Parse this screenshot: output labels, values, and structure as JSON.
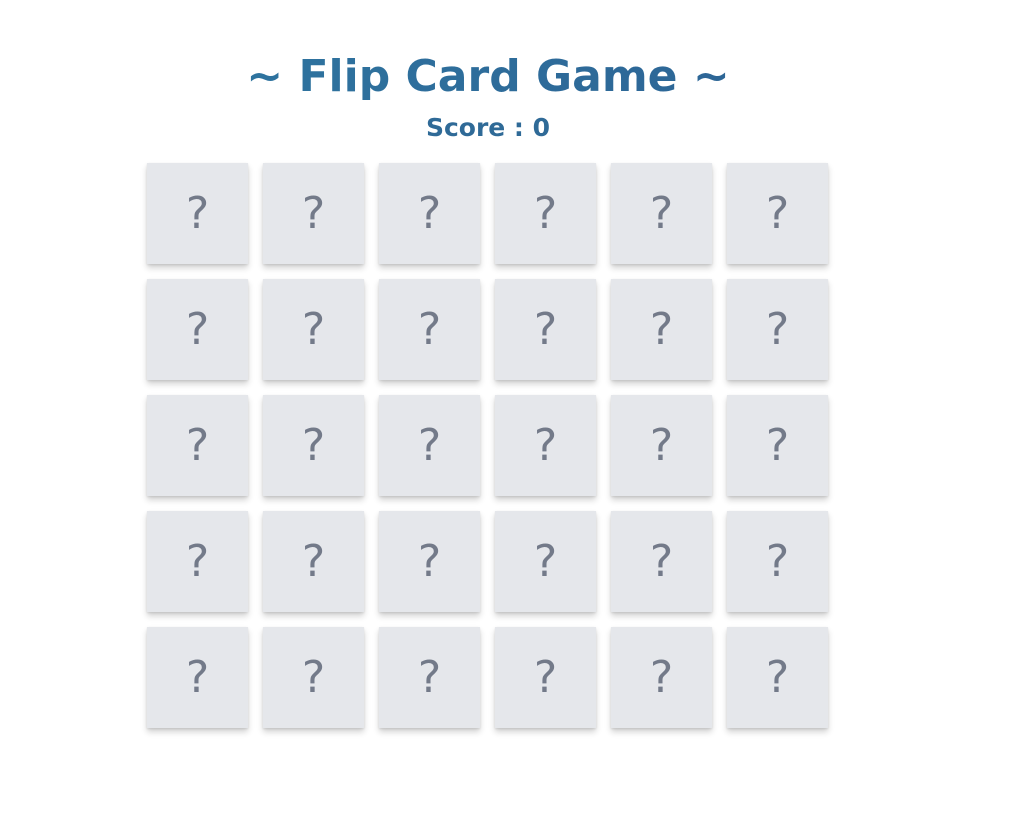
{
  "game": {
    "title": "~ Flip Card Game ~",
    "score_label": "Score : ",
    "score_value": "0"
  },
  "board": {
    "rows": 5,
    "columns": 6,
    "hidden_symbol": "?",
    "cards": [
      {
        "state": "hidden"
      },
      {
        "state": "hidden"
      },
      {
        "state": "hidden"
      },
      {
        "state": "hidden"
      },
      {
        "state": "hidden"
      },
      {
        "state": "hidden"
      },
      {
        "state": "hidden"
      },
      {
        "state": "hidden"
      },
      {
        "state": "hidden"
      },
      {
        "state": "hidden"
      },
      {
        "state": "hidden"
      },
      {
        "state": "hidden"
      },
      {
        "state": "hidden"
      },
      {
        "state": "hidden"
      },
      {
        "state": "hidden"
      },
      {
        "state": "hidden"
      },
      {
        "state": "hidden"
      },
      {
        "state": "hidden"
      },
      {
        "state": "hidden"
      },
      {
        "state": "hidden"
      },
      {
        "state": "hidden"
      },
      {
        "state": "hidden"
      },
      {
        "state": "hidden"
      },
      {
        "state": "hidden"
      },
      {
        "state": "hidden"
      },
      {
        "state": "hidden"
      },
      {
        "state": "hidden"
      },
      {
        "state": "hidden"
      },
      {
        "state": "hidden"
      },
      {
        "state": "hidden"
      }
    ]
  },
  "colors": {
    "title": "#2f6d99",
    "score": "#2f6a97",
    "card_back": "#e5e7eb",
    "card_symbol": "#737a89",
    "background": "#ffffff"
  }
}
